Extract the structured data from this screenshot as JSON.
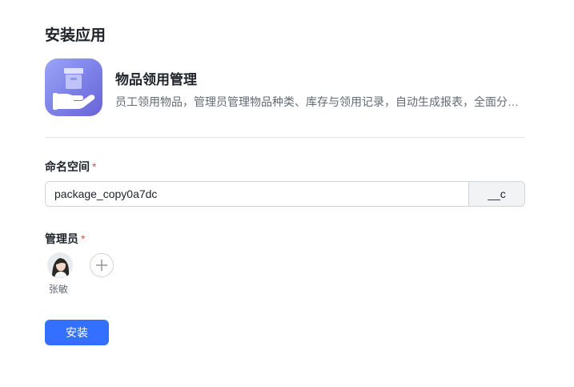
{
  "page": {
    "title": "安装应用"
  },
  "app": {
    "name": "物品领用管理",
    "description": "员工领用物品，管理员管理物品种类、库存与领用记录，自动生成报表，全面分…",
    "icon": "hand-box-icon"
  },
  "namespace": {
    "label": "命名空间",
    "required_mark": "*",
    "value": "package_copy0a7dc",
    "suffix": "__c"
  },
  "admins": {
    "label": "管理员",
    "required_mark": "*",
    "members": [
      {
        "name": "张敏"
      }
    ],
    "add_icon": "plus-icon"
  },
  "actions": {
    "install_label": "安装"
  },
  "colors": {
    "primary": "#3370ff",
    "required": "#f54a45",
    "icon_bg": "#7b7fe6"
  }
}
